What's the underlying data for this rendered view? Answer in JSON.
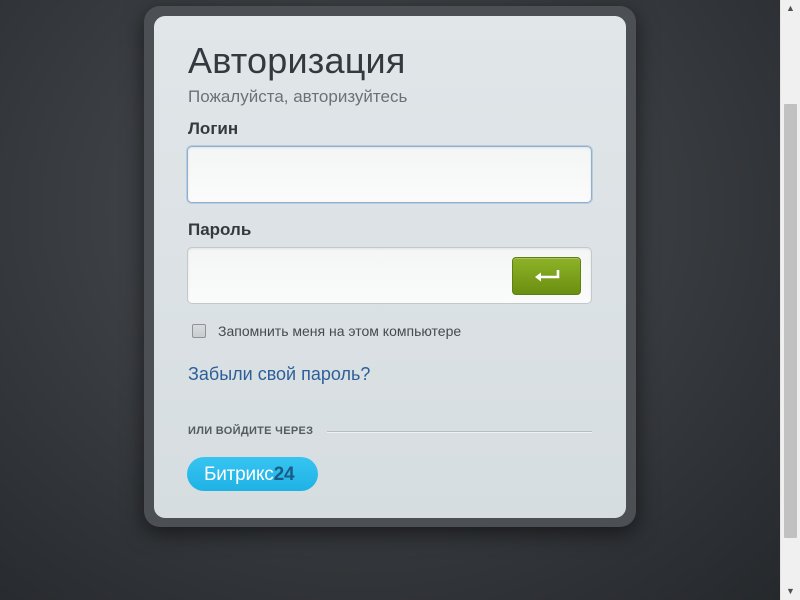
{
  "login_card": {
    "title": "Авторизация",
    "subtitle": "Пожалуйста, авторизуйтесь",
    "login_label": "Логин",
    "login_value": "",
    "password_label": "Пароль",
    "password_value": "",
    "submit_icon": "enter-arrow-icon",
    "remember_label": "Запомнить меня на этом компьютере",
    "remember_checked": false,
    "forgot_link": "Забыли свой пароль?",
    "or_login_via": "ИЛИ ВОЙДИТЕ ЧЕРЕЗ",
    "bitrix_label": "Битрикс",
    "bitrix_number": "24"
  },
  "colors": {
    "accent_green": "#7aa01a",
    "link_blue": "#2d5f9a",
    "bitrix_blue": "#2bbbec"
  }
}
